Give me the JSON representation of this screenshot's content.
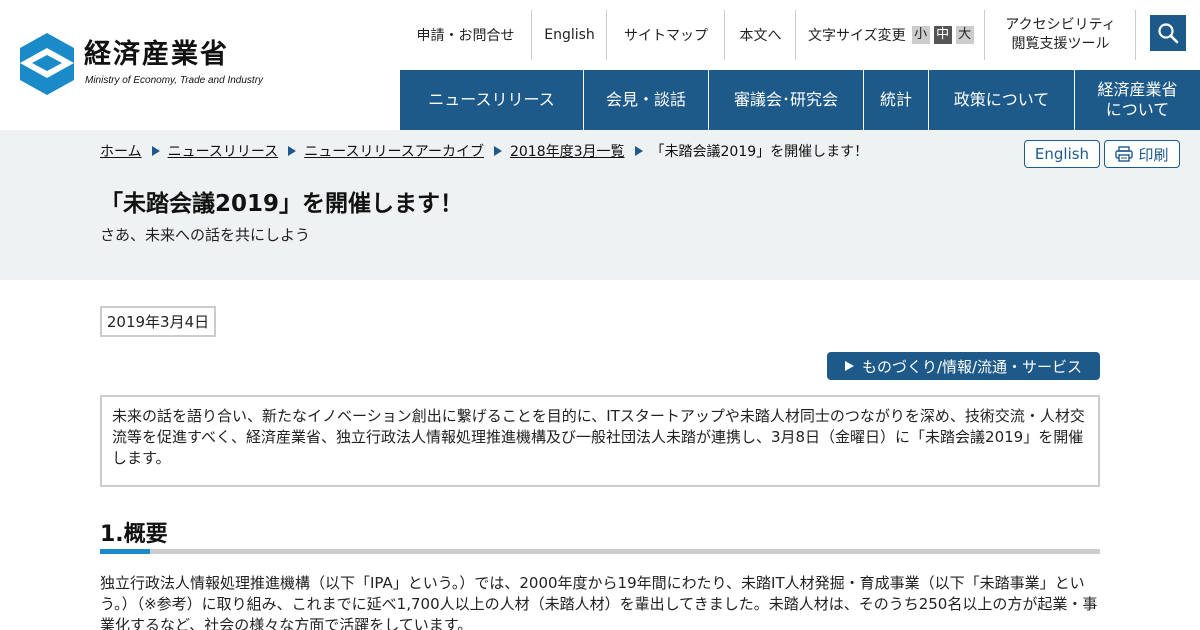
{
  "logo": {
    "name": "経済産業省",
    "sub": "Ministry of Economy, Trade and Industry",
    "color": "#1a8ac9"
  },
  "utility_nav": {
    "contact": "申請・お問合せ",
    "english": "English",
    "sitemap": "サイトマップ",
    "skip": "本文へ",
    "font_size_label": "文字サイズ変更",
    "font_sizes": [
      "小",
      "中",
      "大"
    ],
    "font_size_selected": "中",
    "accessibility_line1": "アクセシビリティ",
    "accessibility_line2": "閲覧支援ツール",
    "search_icon": "search-icon"
  },
  "global_nav": [
    "ニュースリリース",
    "会見・談話",
    "審議会･研究会",
    "統計",
    "政策について",
    "経済産業省\nについて"
  ],
  "breadcrumb": [
    "ホーム",
    "ニュースリリース",
    "ニュースリリースアーカイブ",
    "2018年度3月一覧"
  ],
  "breadcrumb_current": "「未踏会議2019」を開催します！",
  "tools": {
    "english": "English",
    "print": "印刷",
    "print_icon": "printer-icon"
  },
  "page": {
    "title": "「未踏会議2019」を開催します！",
    "subtitle": "さあ、未来への話を共にしよう",
    "date": "2019年3月4日",
    "category": "ものづくり/情報/流通・サービス",
    "lead": "未来の話を語り合い、新たなイノベーション創出に繋げることを目的に、ITスタートアップや未踏人材同士のつながりを深め、技術交流・人材交流等を促進すべく、経済産業省、独立行政法人情報処理推進機構及び一般社団法人未踏が連携し、3月8日（金曜日）に「未踏会議2019」を開催します。",
    "section_heading": "1.概要",
    "section_body": "独立行政法人情報処理推進機構（以下「IPA」という。）では、2000年度から19年間にわたり、未踏IT人材発掘・育成事業（以下「未踏事業」という。）（※参考）に取り組み、これまでに延べ1,700人以上の人材（未踏人材）を輩出してきました。未踏人材は、そのうち250名以上の方が起業・事業化するなど、社会の様々な方面で活躍をしています。"
  },
  "colors": {
    "primary": "#1d5a8a",
    "accent": "#1a8ac9",
    "band": "#eff2f3"
  }
}
